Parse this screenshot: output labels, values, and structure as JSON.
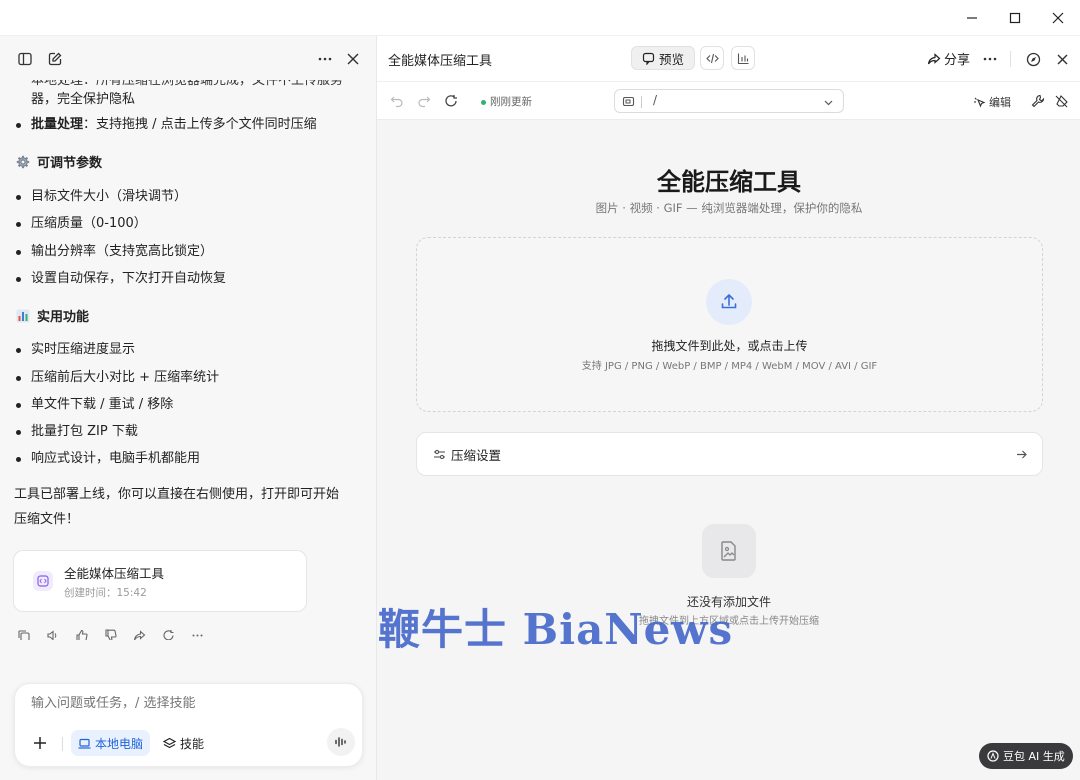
{
  "left_panel": {
    "lines": [
      {
        "text": "本地处理：所有压缩在浏览器端完成，文件不上传服务",
        "bold_prefix": ""
      },
      {
        "text": "器，完全保护隐私"
      }
    ],
    "batch": {
      "bold": "批量处理",
      "text": "：支持拖拽 / 点击上传多个文件同时压缩"
    },
    "section_params": {
      "title": "可调节参数",
      "icon": "gear-icon"
    },
    "params": [
      "目标文件大小（滑块调节）",
      "压缩质量（0-100）",
      "输出分辨率（支持宽高比锁定）",
      "设置自动保存，下次打开自动恢复"
    ],
    "section_features": {
      "title": "实用功能",
      "icon": "bar-chart-icon"
    },
    "features": [
      "实时压缩进度显示",
      "压缩前后大小对比 + 压缩率统计",
      "单文件下载 / 重试 / 移除",
      "批量打包 ZIP 下载",
      "响应式设计，电脑手机都能用"
    ],
    "closing": [
      "工具已部署上线，你可以直接在右侧使用，打开即可开始",
      "压缩文件！"
    ],
    "card": {
      "title": "全能媒体压缩工具",
      "subtitle": "创建时间：15:42"
    },
    "composer": {
      "placeholder": "输入问题或任务，/ 选择技能",
      "local_label": "本地电脑",
      "skill_label": "技能"
    }
  },
  "right_panel": {
    "header": {
      "title": "全能媒体压缩工具",
      "preview_label": "预览",
      "share_label": "分享"
    },
    "address": {
      "status": "刚刚更新",
      "url": "/",
      "edit_label": "编辑"
    },
    "app": {
      "title": "全能压缩工具",
      "subtitle": "图片 · 视频 · GIF — 纯浏览器端处理，保护你的隐私",
      "drop_main": "拖拽文件到此处，或点击上传",
      "drop_sub": "支持 JPG / PNG / WebP / BMP / MP4 / WebM / MOV / AVI / GIF",
      "settings_label": "压缩设置",
      "empty_title": "还没有添加文件",
      "empty_sub": "拖拽文件到上方区域或点击上传开始压缩"
    }
  },
  "watermark": "鞭牛士 BiaNews",
  "ai_badge": "豆包 AI 生成",
  "colors": {
    "accent": "#1e62d9",
    "status_green": "#2fb36d",
    "watermark": "#3f63c9"
  }
}
